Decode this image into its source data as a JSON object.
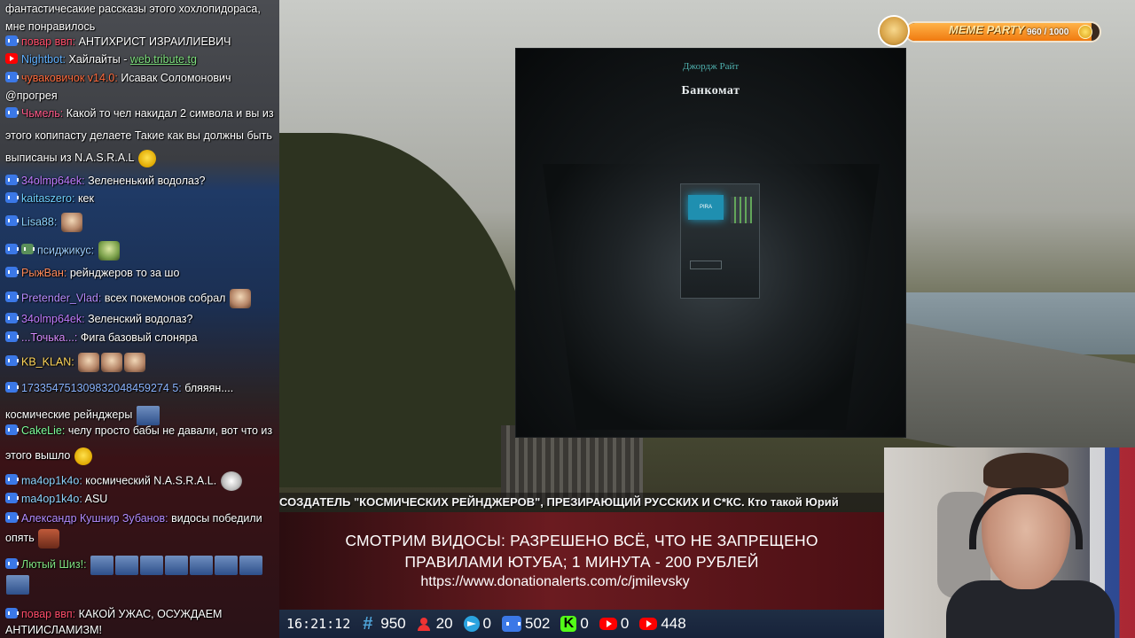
{
  "chat": {
    "messages": [
      {
        "top": 0,
        "icon": "",
        "nick": "",
        "nick_color": "#ffffff",
        "text": "фантастичесакие рассказы этого хохлопидораса, мне понравилось",
        "emotes": []
      },
      {
        "icon": "vk",
        "nick": "повар ввп:",
        "nick_color": "#ff4d6a",
        "text": "АНТИХРИСТ ИЗРАИЛИЕВИЧ",
        "emotes": []
      },
      {
        "icon": "yt",
        "nick": "Nightbot:",
        "nick_color": "#5fb0ff",
        "text": "Хайлайты -",
        "link": "web.tribute.tg",
        "emotes": []
      },
      {
        "icon": "vk",
        "nick": "чуваковичок v14.0:",
        "nick_color": "#ff6b3d",
        "text": "Исавак Соломонович @прогрея",
        "emotes": []
      },
      {
        "icon": "vk",
        "nick": "Чьмель:",
        "nick_color": "#ff5a8a",
        "text": "Какой то чел накидал 2 символа и вы из этого копипасту делаете Такие как вы должны быть выписаны из N.A.S.R.A.L",
        "emotes": []
      },
      {
        "icon": "vk",
        "nick": "34olmp64ek:",
        "nick_color": "#c07cff",
        "text": "Зелененький водолаз?",
        "emotes": []
      },
      {
        "icon": "vk",
        "nick": "kaitaszero:",
        "nick_color": "#6fd0ff",
        "text": "кек",
        "emotes": []
      },
      {
        "icon": "vk",
        "nick": "Lisa88:",
        "nick_color": "#8fd5ff",
        "text": "",
        "emotes": []
      },
      {
        "icon": "vk",
        "nick": "псиджикус:",
        "nick_color": "#9fd0ff",
        "text": "",
        "emotes": []
      },
      {
        "icon": "vk",
        "nick": "РыжВан:",
        "nick_color": "#ff8a5a",
        "text": "рейнджеров то за шо",
        "emotes": []
      },
      {
        "icon": "vk",
        "nick": "Pretender_Vlad:",
        "nick_color": "#b58cff",
        "text": "всех покемонов собрал",
        "emotes": []
      },
      {
        "icon": "vk",
        "nick": "34olmp64ek:",
        "nick_color": "#c07cff",
        "text": "Зеленский водолаз?",
        "emotes": []
      },
      {
        "icon": "vk",
        "nick": "...Точька...:",
        "nick_color": "#d68cff",
        "text": "Фига базовый слоняра",
        "emotes": []
      },
      {
        "icon": "vk",
        "nick": "KB_KLAN:",
        "nick_color": "#ffd65a",
        "text": "",
        "emotes": []
      },
      {
        "icon": "vk",
        "nick": "173354751309832048459274 5:",
        "nick_color": "#8ab4ff",
        "text": "бляяян.... космические рейнджеры",
        "emotes": []
      },
      {
        "icon": "vk",
        "nick": "CakeLie:",
        "nick_color": "#7dff9a",
        "text": "челу просто бабы не давали, вот что из этого вышло",
        "emotes": []
      },
      {
        "icon": "vk",
        "nick": "ma4op1k4o:",
        "nick_color": "#8fd5ff",
        "text": "космический N.A.S.R.A.L.",
        "emotes": []
      },
      {
        "icon": "vk",
        "nick": "ma4op1k4o:",
        "nick_color": "#8fd5ff",
        "text": "ASU",
        "emotes": []
      },
      {
        "icon": "vk",
        "nick": "Александр Кушнир Зубанов:",
        "nick_color": "#b58cff",
        "text": "видосы победили опять",
        "emotes": []
      },
      {
        "icon": "vk",
        "nick": "Лютый Шиз!:",
        "nick_color": "#7fe07f",
        "text": "",
        "emotes": []
      },
      {
        "icon": "vk",
        "nick": "повар ввп:",
        "nick_color": "#ff4d6a",
        "text": "КАКОЙ УЖАС, ОСУЖДАЕМ АНТИИСЛАМИЗМ!",
        "emotes": []
      }
    ]
  },
  "cover": {
    "author": "Джордж Райт",
    "title": "Банкомат",
    "atm_screen": "PIRA"
  },
  "party": {
    "label": "MEME PARTY",
    "count": "960 / 1000",
    "progress": 0.96
  },
  "ticker": {
    "text": "СОЗДАТЕЛЬ \"КОСМИЧЕСКИХ РЕЙНДЖЕРОВ\", ПРЕЗИРАЮЩИЙ РУССКИХ И С*КС. Кто такой Юрий"
  },
  "donate": {
    "line1": "СМОТРИМ ВИДОСЫ: РАЗРЕШЕНО ВСЁ, ЧТО НЕ ЗАПРЕЩЕНО",
    "line2": "ПРАВИЛАМИ ЮТУБА; 1 МИНУТА - 200 РУБЛЕЙ",
    "line3": "https://www.donationalerts.com/c/jmilevsky"
  },
  "status": {
    "time": "16:21:12",
    "items": [
      {
        "icon": "hash-icon",
        "value": "950"
      },
      {
        "icon": "people-icon",
        "value": "20"
      },
      {
        "icon": "telegram-icon",
        "value": "0"
      },
      {
        "icon": "vk-icon",
        "value": "502"
      },
      {
        "icon": "kick-icon",
        "value": "0"
      },
      {
        "icon": "youtube-icon",
        "value": "0"
      },
      {
        "icon": "youtube-icon",
        "value": "448"
      }
    ]
  }
}
